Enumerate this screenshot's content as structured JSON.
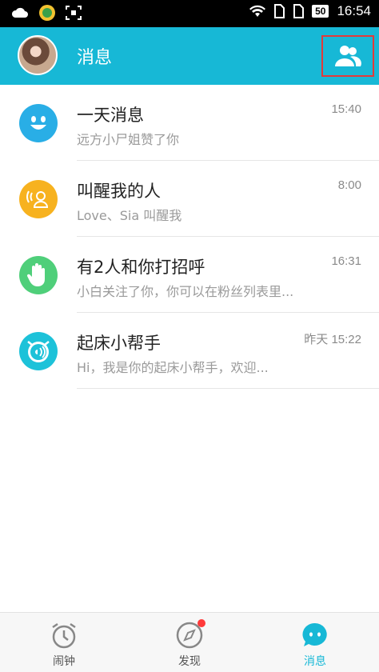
{
  "status_bar": {
    "time": "16:54",
    "battery": "50"
  },
  "header": {
    "title": "消息"
  },
  "messages": [
    {
      "name": "一天消息",
      "preview": "远方小尸姐赞了你",
      "time": "15:40",
      "color": "#29aee6"
    },
    {
      "name": "叫醒我的人",
      "preview": "Love、Sia 叫醒我",
      "time": "8:00",
      "color": "#f7b21f"
    },
    {
      "name": "有2人和你打招呼",
      "preview": "小白关注了你，你可以在粉丝列表里...",
      "time": "16:31",
      "color": "#4fcf7a"
    },
    {
      "name": "起床小帮手",
      "preview": "Hi，我是你的起床小帮手，欢迎...",
      "time": "昨天 15:22",
      "color": "#1dc2d9"
    }
  ],
  "tabs": [
    {
      "label": "闹钟",
      "icon": "alarm-clock-icon"
    },
    {
      "label": "发现",
      "icon": "compass-icon"
    },
    {
      "label": "消息",
      "icon": "chat-bubble-icon"
    }
  ],
  "colors": {
    "accent": "#17b8d6",
    "badge": "#ff3a3a"
  }
}
